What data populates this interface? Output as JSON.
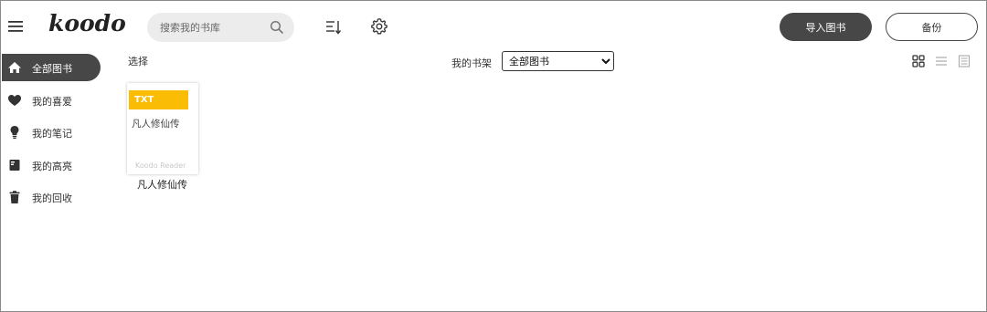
{
  "header": {
    "logo_text": "koodo",
    "search_placeholder": "搜索我的书库",
    "import_label": "导入图书",
    "backup_label": "备份"
  },
  "sidebar": {
    "items": [
      {
        "label": "全部图书",
        "icon": "home-icon",
        "active": true
      },
      {
        "label": "我的喜爱",
        "icon": "heart-icon",
        "active": false
      },
      {
        "label": "我的笔记",
        "icon": "bulb-icon",
        "active": false
      },
      {
        "label": "我的高亮",
        "icon": "highlight-book-icon",
        "active": false
      },
      {
        "label": "我的回收",
        "icon": "trash-icon",
        "active": false
      }
    ]
  },
  "toolbar": {
    "select_label": "选择",
    "shelf_label": "我的书架",
    "shelf_selected": "全部图书",
    "view_modes": [
      "grid-view-icon",
      "list-view-icon",
      "card-list-view-icon"
    ],
    "active_view": "grid-view-icon"
  },
  "books": [
    {
      "format": "TXT",
      "cover_title": "凡人修仙传",
      "watermark": "Koodo Reader",
      "name": "凡人修仙传"
    }
  ],
  "colors": {
    "accent_dark": "#474747",
    "badge_yellow": "#fbbc05"
  }
}
